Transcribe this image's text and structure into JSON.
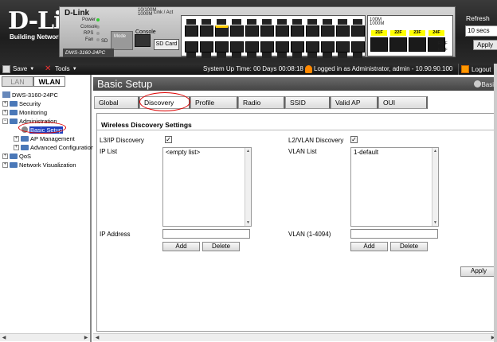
{
  "banner": {
    "logo": "D-Link",
    "tagline": "Building Networks for Pe",
    "panel_brand": "D-Link",
    "model": "DWS-3160-24PC",
    "led_labels": [
      "Power",
      "Console",
      "RPS",
      "Fan",
      "SD"
    ],
    "speed_legend": "10/100M\n1000M",
    "link_act": "Link / Act",
    "console": "Console",
    "sd_card": "SD Card",
    "mode": "Mode",
    "sfp_labels": [
      "21F",
      "22F",
      "23F",
      "24F"
    ],
    "sfp_side": [
      "F21F",
      "F24F"
    ],
    "speed_sfp": "100M\n1000M"
  },
  "refresh": {
    "label": "Refresh",
    "value": "10 secs",
    "apply": "Apply"
  },
  "toolbar": {
    "save": "Save",
    "tools": "Tools",
    "uptime": "System Up Time: 00 Days 00:08:18",
    "admin_info": "Logged in as Administrator, admin - 10.90.90.100",
    "logout": "Logout"
  },
  "nav": {
    "tabs": [
      "LAN",
      "WLAN"
    ],
    "root": "DWS-3160-24PC",
    "security": "Security",
    "monitoring": "Monitoring",
    "administration": "Administration",
    "basic_setup": "Basic Setup",
    "ap_management": "AP Management",
    "advanced_config": "Advanced Configuration",
    "qos": "QoS",
    "network_vis": "Network Visualization"
  },
  "page": {
    "title": "Basic Setup",
    "help": "Basic",
    "tabs": [
      "Global",
      "Discovery",
      "Profile",
      "Radio",
      "SSID",
      "Valid AP",
      "OUI"
    ],
    "section_title": "Wireless Discovery Settings",
    "l3_discovery": "L3/IP Discovery",
    "l2_discovery": "L2/VLAN Discovery",
    "ip_list_label": "IP List",
    "vlan_list_label": "VLAN List",
    "ip_list_item": "<empty list>",
    "vlan_list_item": "1-default",
    "ip_address_label": "IP Address",
    "vlan_label": "VLAN (1-4094)",
    "ip_address_value": "",
    "vlan_value": "",
    "add": "Add",
    "delete": "Delete",
    "apply": "Apply"
  }
}
